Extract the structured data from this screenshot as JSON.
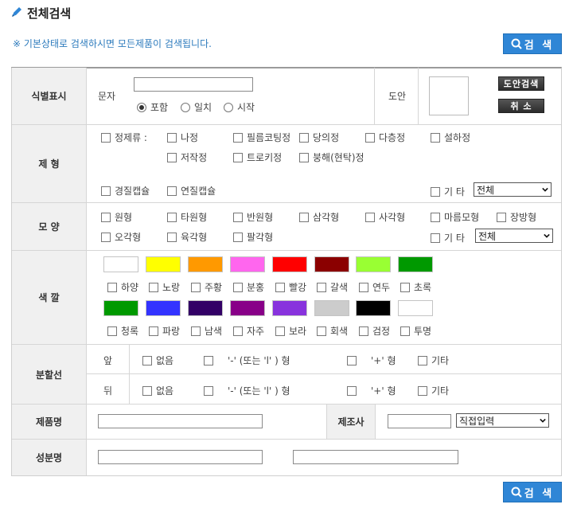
{
  "header": {
    "title": "전체검색",
    "hint": "※ 기본상태로 검색하시면 모든제품이 검색됩니다.",
    "search_label": "검 색"
  },
  "identification": {
    "label": "식별표시",
    "text_label": "문자",
    "radios": [
      {
        "label": "포함",
        "checked": true
      },
      {
        "label": "일치",
        "checked": false
      },
      {
        "label": "시작",
        "checked": false
      }
    ],
    "drawing_label": "도안",
    "drawing_search_button": "도안검색",
    "cancel_button": "취 소"
  },
  "dosage_form": {
    "label": "제 형",
    "items": [
      "정제류 :",
      "나정",
      "필름코팅정",
      "당의정",
      "다층정",
      "설하정",
      "저작정",
      "트로키정",
      "붕해(현탁)정",
      "경질캡슐",
      "연질캡슐"
    ],
    "other_label": "기 타",
    "other_select": "전체"
  },
  "shape": {
    "label": "모 양",
    "items": [
      "원형",
      "타원형",
      "반원형",
      "삼각형",
      "사각형",
      "마름모형",
      "장방형",
      "오각형",
      "육각형",
      "팔각형"
    ],
    "other_label": "기 타",
    "other_select": "전체"
  },
  "color": {
    "label": "색 깔",
    "row1": [
      {
        "name": "하양",
        "hex": "#ffffff"
      },
      {
        "name": "노랑",
        "hex": "#ffff00"
      },
      {
        "name": "주황",
        "hex": "#ff9900"
      },
      {
        "name": "분홍",
        "hex": "#ff66ee"
      },
      {
        "name": "빨강",
        "hex": "#ff0000"
      },
      {
        "name": "갈색",
        "hex": "#8b0000"
      },
      {
        "name": "연두",
        "hex": "#99ff33"
      },
      {
        "name": "초록",
        "hex": "#009900"
      }
    ],
    "row2": [
      {
        "name": "청록",
        "hex": "#009900"
      },
      {
        "name": "파랑",
        "hex": "#3333ff"
      },
      {
        "name": "남색",
        "hex": "#330066"
      },
      {
        "name": "자주",
        "hex": "#880088"
      },
      {
        "name": "보라",
        "hex": "#8833dd"
      },
      {
        "name": "회색",
        "hex": "#cccccc"
      },
      {
        "name": "검정",
        "hex": "#000000"
      },
      {
        "name": "투명",
        "hex": "#ffffff"
      }
    ]
  },
  "score_line": {
    "label": "분할선",
    "front": "앞",
    "back": "뒤",
    "options": [
      "없음",
      "'-' (또는 'l' ) 형",
      "'+' 형",
      "기타"
    ]
  },
  "product": {
    "label": "제품명",
    "maker_label": "제조사",
    "maker_select": "직접입력"
  },
  "ingredient": {
    "label": "성분명"
  }
}
